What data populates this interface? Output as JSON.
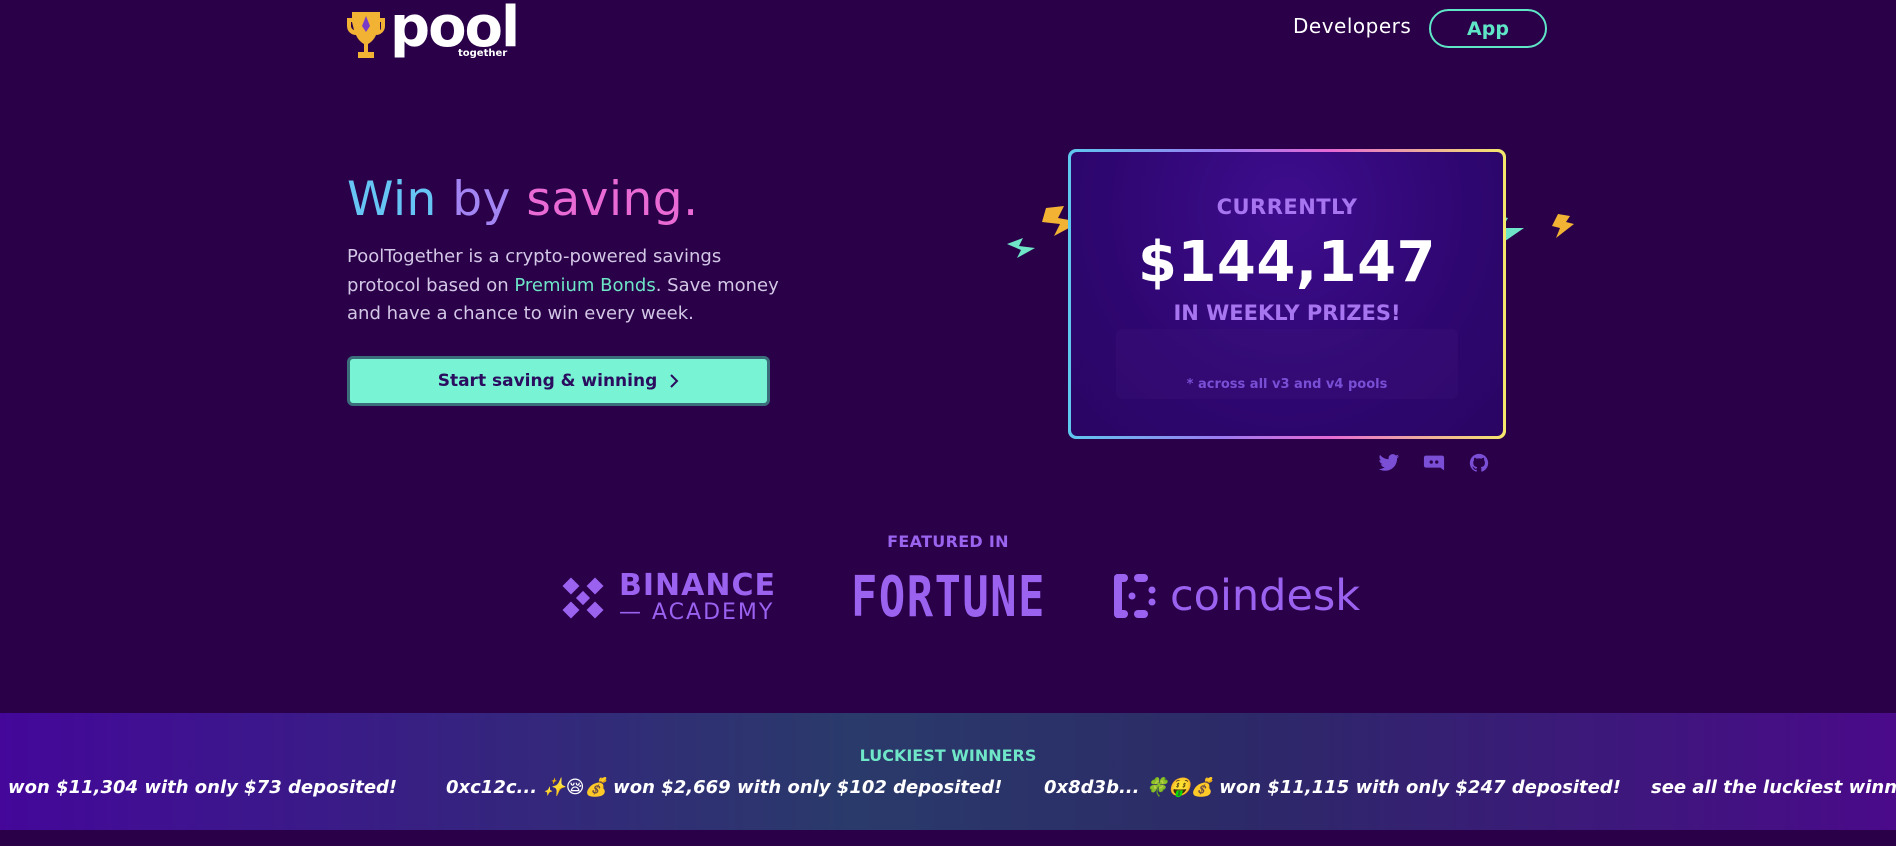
{
  "header": {
    "logo_text": "pool",
    "logo_sub": "together",
    "nav_developers": "Developers",
    "nav_app": "App"
  },
  "hero": {
    "title_win": "Win",
    "title_by": "by",
    "title_saving": "saving.",
    "desc_before": "PoolTogether is a crypto-powered savings protocol based on ",
    "desc_link": "Premium Bonds",
    "desc_after": ". Save money and have a chance to win every week.",
    "cta_label": "Start saving & winning"
  },
  "prize": {
    "label_top": "CURRENTLY",
    "amount": "$144,147",
    "label_bottom": "IN WEEKLY PRIZES!",
    "note": "* across all v3 and v4 pools"
  },
  "featured": {
    "title": "FEATURED IN",
    "binance_line1": "BINANCE",
    "binance_line2": "— ACADEMY",
    "fortune": "FORTUNE",
    "coindesk": "coindesk"
  },
  "winners": {
    "title": "LUCKIEST WINNERS",
    "items": [
      "won $11,304 with only $73 deposited!",
      "0xc12c... ✨😪💰 won $2,669 with only $102 deposited!",
      "0x8d3b... 🍀🤑💰 won $11,115 with only $247 deposited!",
      "see all the luckiest winners"
    ]
  },
  "colors": {
    "background": "#2a0049",
    "accent_teal": "#78f3d3",
    "accent_purple": "#9b62f0"
  }
}
